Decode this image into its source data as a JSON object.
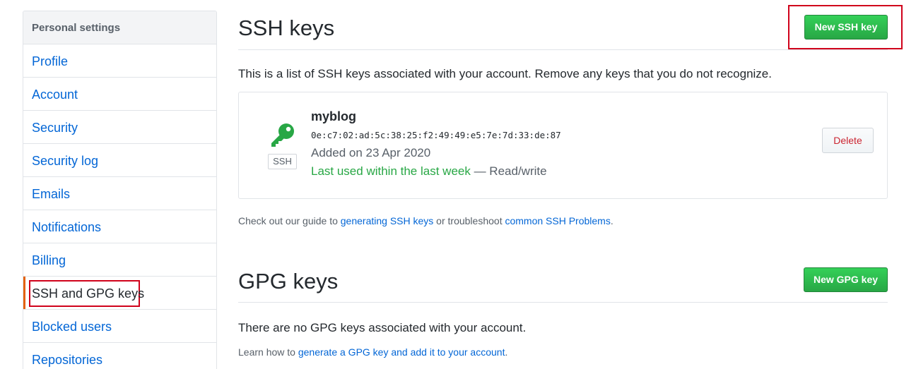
{
  "sidebar": {
    "header": "Personal settings",
    "items": [
      {
        "label": "Profile"
      },
      {
        "label": "Account"
      },
      {
        "label": "Security"
      },
      {
        "label": "Security log"
      },
      {
        "label": "Emails"
      },
      {
        "label": "Notifications"
      },
      {
        "label": "Billing"
      },
      {
        "label": "SSH and GPG keys",
        "selected": true
      },
      {
        "label": "Blocked users"
      },
      {
        "label": "Repositories"
      }
    ]
  },
  "ssh": {
    "title": "SSH keys",
    "new_button": "New SSH key",
    "description": "This is a list of SSH keys associated with your account. Remove any keys that you do not recognize.",
    "key": {
      "name": "myblog",
      "fingerprint": "0e:c7:02:ad:5c:38:25:f2:49:49:e5:7e:7d:33:de:87",
      "added": "Added on 23 Apr 2020",
      "last_used": "Last used within the last week",
      "access": " — Read/write",
      "badge": "SSH",
      "icon": "key-icon",
      "delete_button": "Delete"
    },
    "guide": {
      "prefix": "Check out our guide to ",
      "link1": "generating SSH keys",
      "middle": " or troubleshoot ",
      "link2": "common SSH Problems",
      "suffix": "."
    }
  },
  "gpg": {
    "title": "GPG keys",
    "new_button": "New GPG key",
    "empty": "There are no GPG keys associated with your account.",
    "learn": {
      "prefix": "Learn how to ",
      "link": "generate a GPG key and add it to your account",
      "suffix": "."
    }
  },
  "colors": {
    "accent_blue": "#0366d6",
    "green": "#28a745",
    "danger": "#cb2431",
    "highlight": "#d0021b",
    "selected_bar": "#e36209"
  }
}
